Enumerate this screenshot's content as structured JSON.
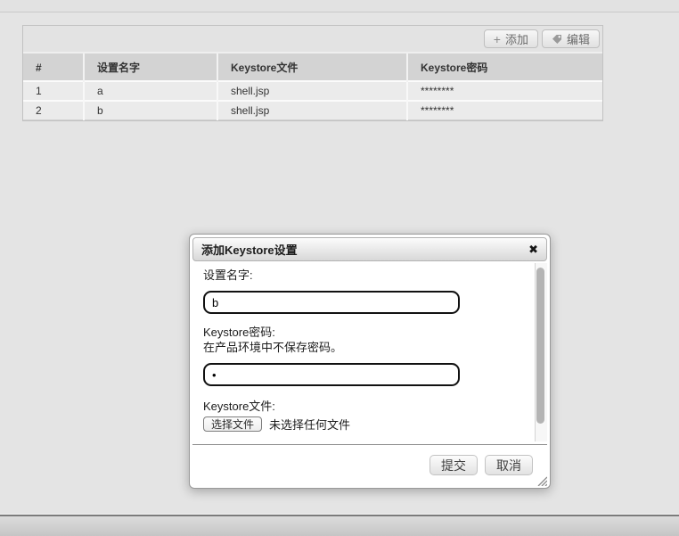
{
  "colors": {
    "page_bg": "#e4e4e4",
    "table_header_bg": "#d3d3d3",
    "row_bg": "#ebebeb",
    "dialog_border": "#999999"
  },
  "toolbar": {
    "add_label": "添加",
    "add_icon_glyph": "+",
    "edit_label": "编辑",
    "edit_icon": "tag-icon"
  },
  "table": {
    "headers": [
      "#",
      "设置名字",
      "Keystore文件",
      "Keystore密码"
    ],
    "rows": [
      {
        "index": "1",
        "name": "a",
        "file": "shell.jsp",
        "password": "********"
      },
      {
        "index": "2",
        "name": "b",
        "file": "shell.jsp",
        "password": "********"
      }
    ]
  },
  "dialog": {
    "title": "添加Keystore设置",
    "close_glyph": "✖",
    "name_label": "设置名字:",
    "name_value": "b",
    "password_label": "Keystore密码:",
    "password_note": "在产品环境中不保存密码。",
    "password_value": "•",
    "file_label": "Keystore文件:",
    "choose_file_label": "选择文件",
    "no_file_text": "未选择任何文件",
    "submit_label": "提交",
    "cancel_label": "取消"
  }
}
